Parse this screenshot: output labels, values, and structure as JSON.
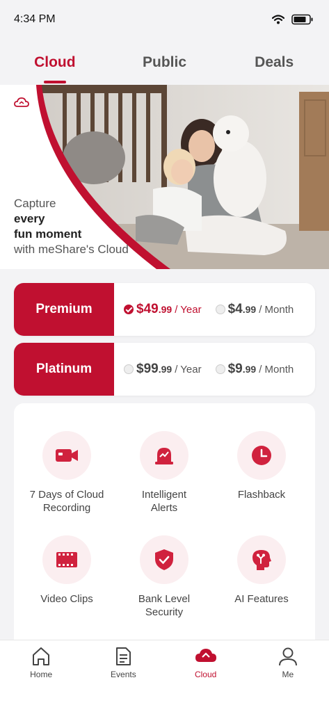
{
  "status": {
    "time": "4:34 PM"
  },
  "tabs": [
    {
      "label": "Cloud",
      "active": true
    },
    {
      "label": "Public",
      "active": false
    },
    {
      "label": "Deals",
      "active": false
    }
  ],
  "banner": {
    "line1": "Capture",
    "line2": "every",
    "line3": "fun moment",
    "line4": "with meShare's Cloud"
  },
  "plans": [
    {
      "name": "Premium",
      "options": [
        {
          "currency": "$",
          "whole": "49",
          "cents": ".99",
          "period": "/ Year",
          "selected": true
        },
        {
          "currency": "$",
          "whole": "4",
          "cents": ".99",
          "period": "/ Month",
          "selected": false
        }
      ]
    },
    {
      "name": "Platinum",
      "options": [
        {
          "currency": "$",
          "whole": "99",
          "cents": ".99",
          "period": "/ Year",
          "selected": false
        },
        {
          "currency": "$",
          "whole": "9",
          "cents": ".99",
          "period": "/ Month",
          "selected": false
        }
      ]
    }
  ],
  "features": [
    {
      "icon": "video-camera-icon",
      "line1": "7 Days of Cloud",
      "line2": "Recording"
    },
    {
      "icon": "alarm-light-icon",
      "line1": "Intelligent",
      "line2": "Alerts"
    },
    {
      "icon": "clock-icon",
      "line1": "Flashback",
      "line2": ""
    },
    {
      "icon": "film-strip-icon",
      "line1": "Video Clips",
      "line2": ""
    },
    {
      "icon": "shield-check-icon",
      "line1": "Bank Level",
      "line2": "Security"
    },
    {
      "icon": "ai-head-icon",
      "line1": "AI Features",
      "line2": ""
    }
  ],
  "nav": [
    {
      "icon": "home-icon",
      "label": "Home",
      "active": false
    },
    {
      "icon": "document-icon",
      "label": "Events",
      "active": false
    },
    {
      "icon": "cloud-icon",
      "label": "Cloud",
      "active": true
    },
    {
      "icon": "person-icon",
      "label": "Me",
      "active": false
    }
  ],
  "colors": {
    "accent": "#c01030",
    "accent_light": "#fbeef0"
  }
}
